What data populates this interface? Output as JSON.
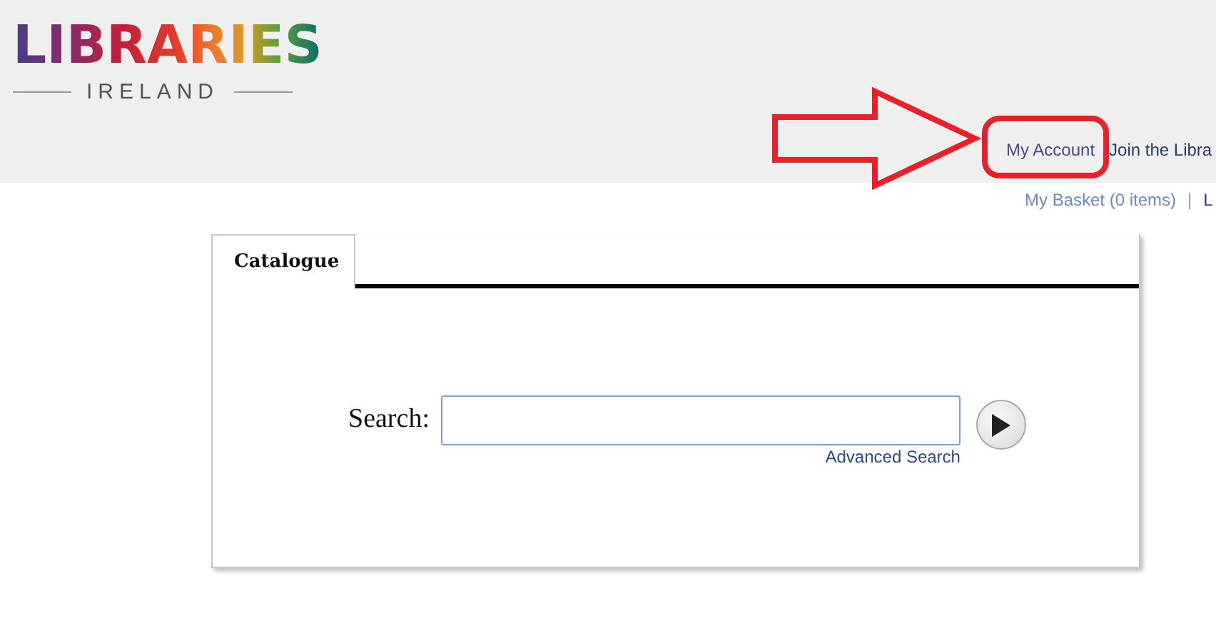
{
  "logo": {
    "title": "LIBRARIES",
    "subtitle": "IRELAND"
  },
  "header_links": [
    "My Account",
    "Join the Libra"
  ],
  "account_links": [
    {
      "label": "My Basket (0 items)"
    },
    {
      "label": "|",
      "kind": "separator"
    },
    {
      "label": "L"
    }
  ],
  "tabs": [
    {
      "label": "Catalogue",
      "selected": true
    }
  ],
  "search": {
    "label": "Search:",
    "advanced_link": "Advanced Search"
  }
}
